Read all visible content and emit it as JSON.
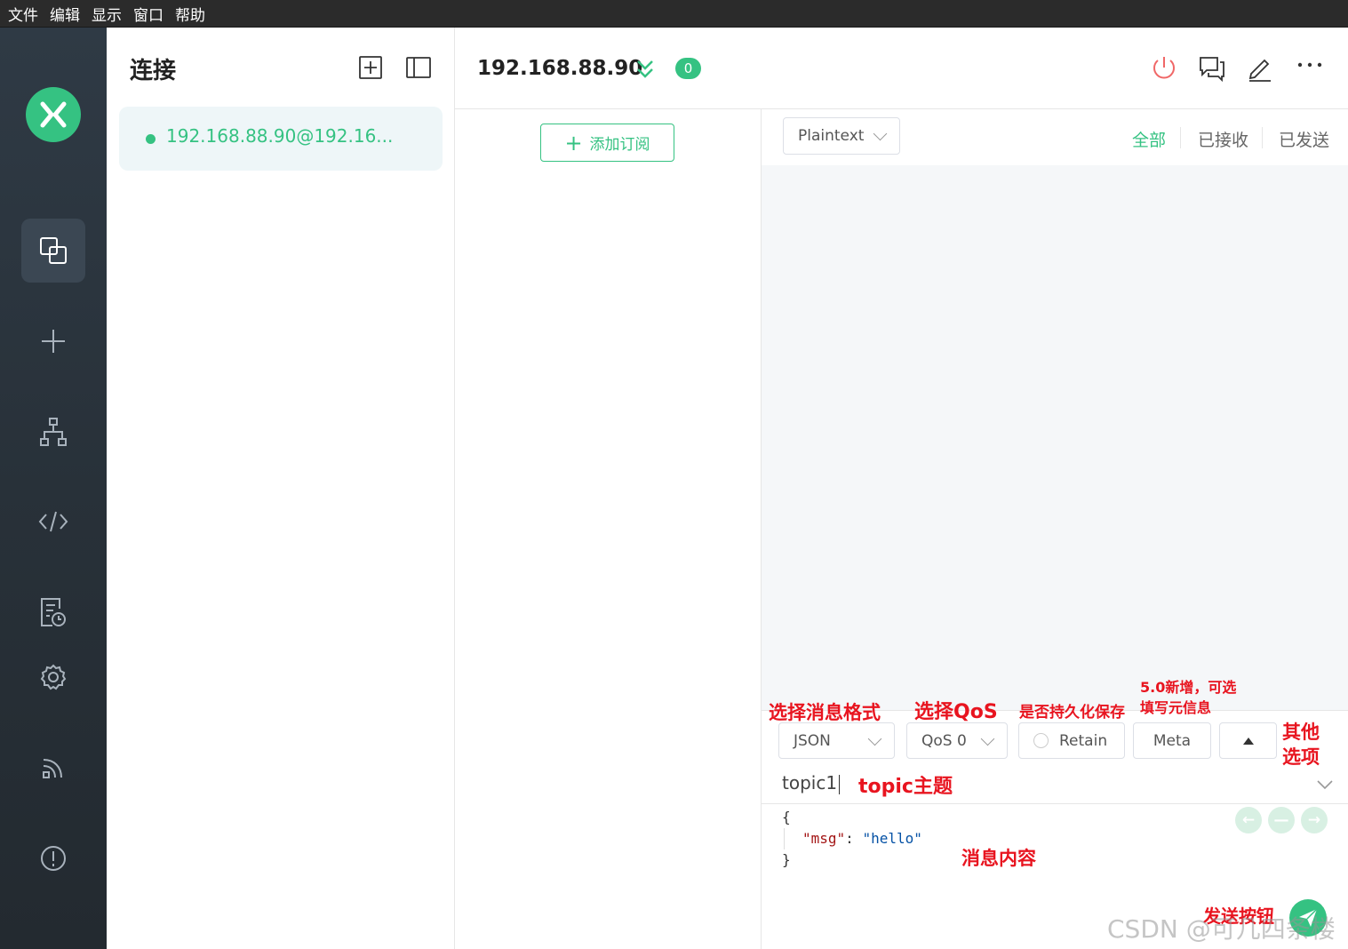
{
  "menubar": [
    "文件",
    "编辑",
    "显示",
    "窗口",
    "帮助"
  ],
  "rail": {
    "icons": [
      "connections-icon",
      "plus-icon",
      "topology-icon",
      "script-icon",
      "log-icon",
      "settings-icon",
      "feed-icon",
      "about-icon"
    ]
  },
  "connections": {
    "title": "连接",
    "items": [
      {
        "name": "192.168.88.90@192.16..."
      }
    ]
  },
  "header": {
    "host": "192.168.88.90",
    "message_count": "0"
  },
  "subscriptions": {
    "add_label": "添加订阅"
  },
  "messages": {
    "payload_format": "Plaintext",
    "filters": [
      "全部",
      "已接收",
      "已发送"
    ],
    "active_filter": "全部"
  },
  "publish": {
    "format": "JSON",
    "qos": "QoS 0",
    "retain_label": "Retain",
    "meta_label": "Meta",
    "topic": "topic1",
    "payload": {
      "open": "{",
      "key": "\"msg\"",
      "colon": ": ",
      "value": "\"hello\"",
      "close": "}"
    }
  },
  "annotations": {
    "format": "选择消息格式",
    "qos": "选择QoS",
    "retain": "是否持久化保存",
    "meta_line1": "5.0新增，可选",
    "meta_line2": "填写元信息",
    "other_line1": "其他",
    "other_line2": "选项",
    "topic": "topic主题",
    "payload": "消息内容",
    "send": "发送按钮"
  },
  "watermark": "CSDN @可几四条楼",
  "colors": {
    "accent": "#35c282",
    "annotation": "#e8141f",
    "rail": "#2f3a45",
    "danger": "#f06767"
  }
}
